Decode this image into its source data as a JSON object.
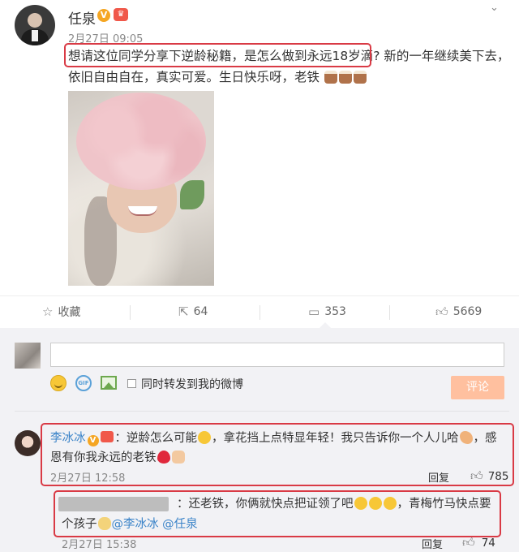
{
  "post": {
    "author_name": "任泉",
    "verified_badge": "V",
    "timestamp": "2月27日 09:05",
    "text_highlighted": "想请这位同学分享下逆龄秘籍，是怎么做到永远18岁滴?",
    "text_rest": "新的一年继续美下去，依旧自由自在，真实可爱。生日快乐呀，老铁",
    "text_emojis": [
      "cake-emoji",
      "cake-emoji",
      "cake-emoji"
    ]
  },
  "actions": {
    "favorite_label": "收藏",
    "repost_count": "64",
    "comment_count": "353",
    "like_count": "5669"
  },
  "composer": {
    "input_value": "",
    "repost_checkbox_label": "同时转发到我的微博",
    "submit_label": "评论",
    "gif_label": "GIF"
  },
  "top_comment": {
    "user": "李冰冰",
    "verified_badge": "V",
    "text_before_emoji": "：逆龄怎么可能",
    "text_middle": "，拿花挡上点特显年轻！我只告诉你一个人儿哈",
    "text_after": "，感恩有你我永远的老铁",
    "timestamp": "2月27日 12:58",
    "reply_label": "回复",
    "likes": "785"
  },
  "nested_reply": {
    "text_main": "：还老铁，你俩就快点把证领了吧",
    "text_second": "，青梅竹马快点要个孩子",
    "mentions": [
      "@李冰冰",
      "@任泉"
    ],
    "timestamp": "2月27日 15:38",
    "reply_label": "回复",
    "likes": "74"
  },
  "colors": {
    "highlight_border": "#d93a45",
    "link_blue": "#3a83c8",
    "submit_button": "#ffc09f",
    "panel_background": "#f2f2f5"
  },
  "icons": [
    "more-chevron-icon",
    "star-icon",
    "repost-icon",
    "comment-icon",
    "thumb-up-icon",
    "emoji-icon",
    "gif-icon",
    "image-icon"
  ]
}
